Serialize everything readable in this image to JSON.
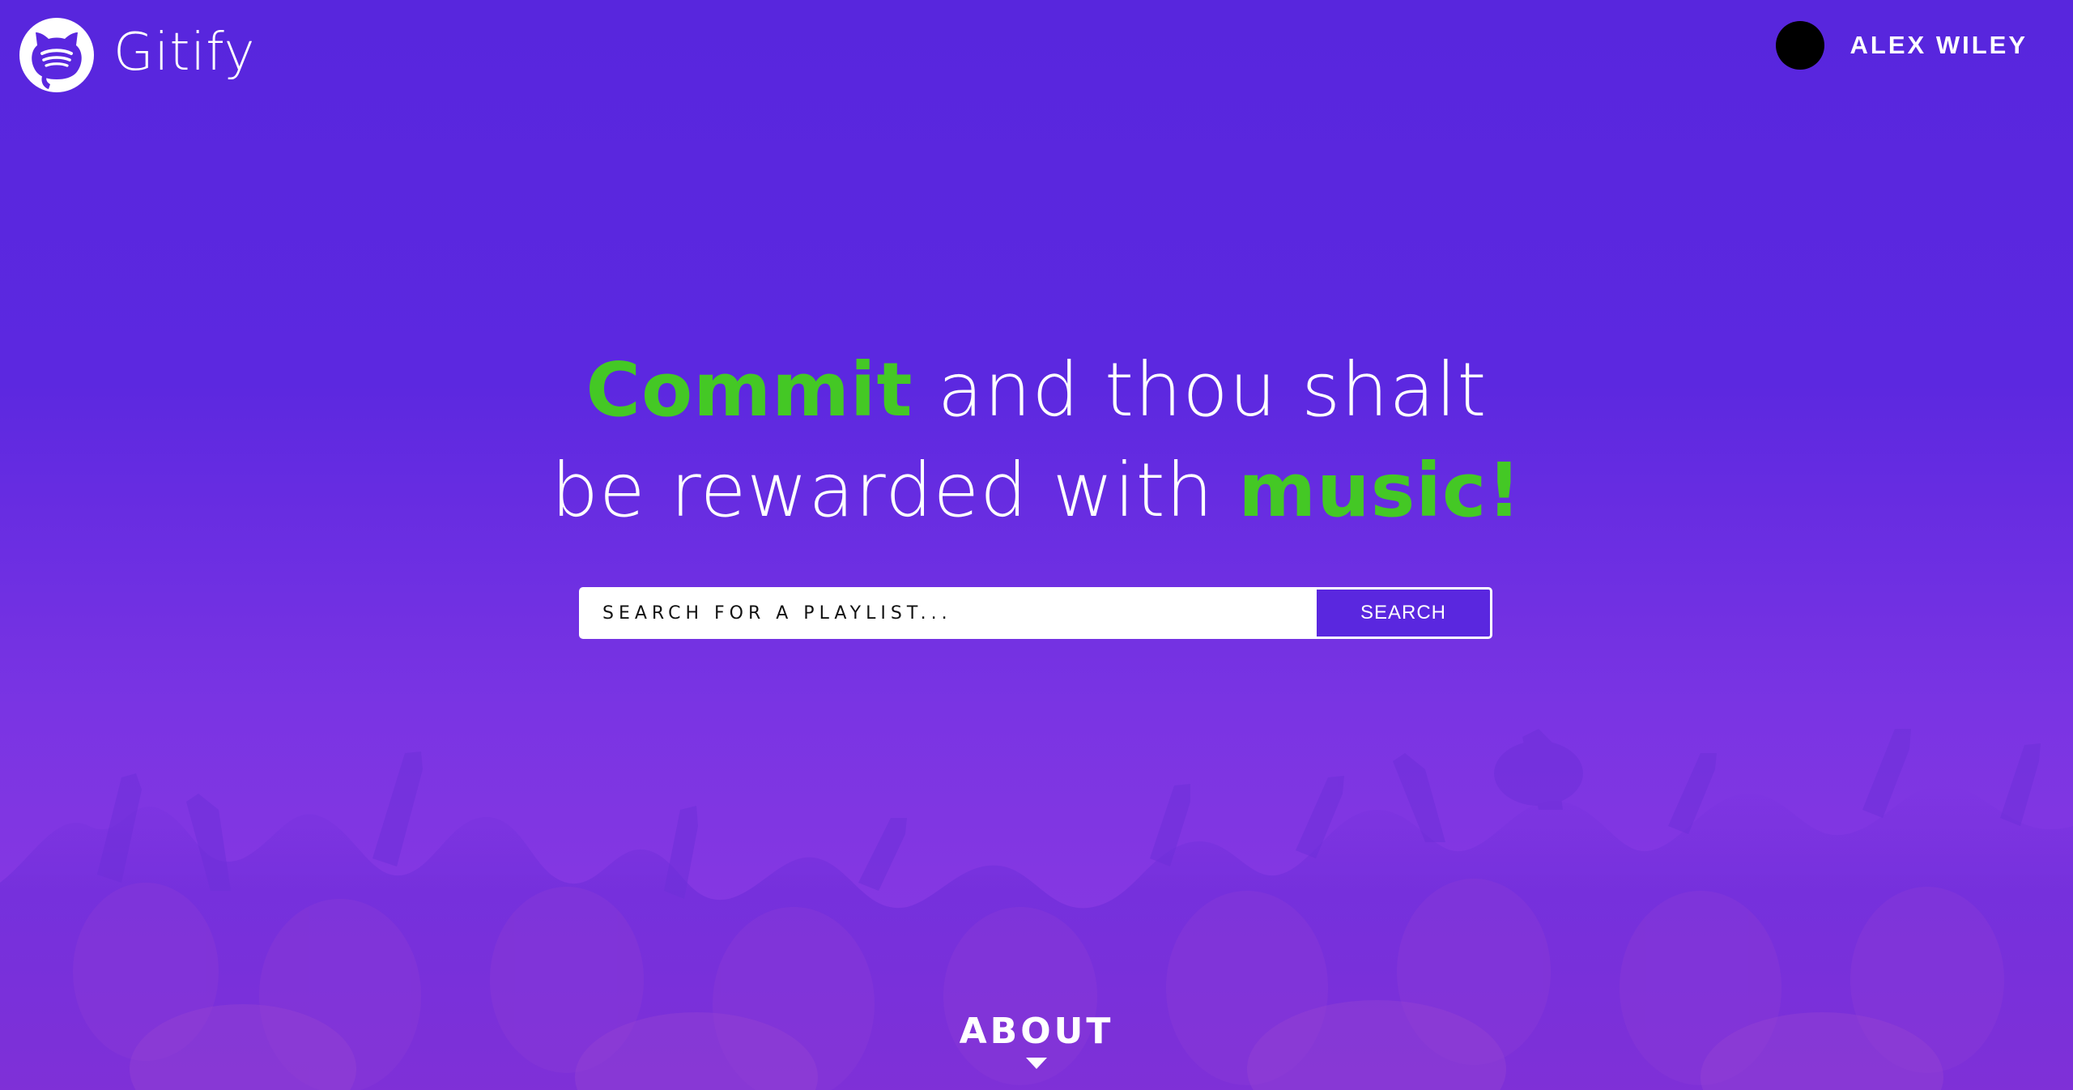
{
  "app": {
    "name": "Gitify",
    "logo_icon": "github-spotify-octocat-icon"
  },
  "user": {
    "name": "ALEX WILEY",
    "avatar_icon": "avatar-circle"
  },
  "hero": {
    "line1_accent": "Commit",
    "line1_rest": " and thou shalt",
    "line2_rest": "be rewarded with ",
    "line2_accent": "music!"
  },
  "search": {
    "placeholder": "SEARCH FOR A PLAYLIST...",
    "button_label": "SEARCH"
  },
  "about": {
    "label": "ABOUT",
    "arrow_icon": "caret-down-icon"
  },
  "colors": {
    "accent_green": "#44c825",
    "brand_purple": "#5a27df",
    "text_white": "#ffffff"
  }
}
